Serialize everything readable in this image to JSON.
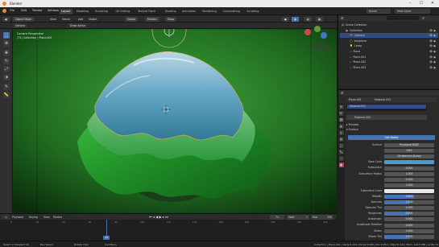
{
  "window": {
    "title": "Blender",
    "minimize": "–",
    "maximize": "☐",
    "close": "✕"
  },
  "menus": [
    "File",
    "Edit",
    "Render",
    "Window",
    "Help"
  ],
  "workspace_tabs": [
    "Layout",
    "Modeling",
    "Sculpting",
    "UV Editing",
    "Texture Paint",
    "Shading",
    "Animation",
    "Rendering",
    "Compositing",
    "Scripting"
  ],
  "active_workspace": "Layout",
  "scene": {
    "name": "Scene",
    "view_layer": "View Layer"
  },
  "viewport_header": {
    "editor": "Object Mode",
    "items": [
      "View",
      "Select",
      "Add",
      "Object"
    ],
    "left_pills": [
      "Options"
    ],
    "transform": [
      "Global",
      "Median"
    ],
    "snap": "Snap",
    "draw_mode": "Draw Active"
  },
  "viewport_info": {
    "line1": "Camera Perspective",
    "line2": "(74) Collection | Plane.001"
  },
  "outliner": {
    "title": "Scene Collection",
    "rows": [
      {
        "label": "Scene Collection",
        "selected": false,
        "indent": 0
      },
      {
        "label": "Collection",
        "selected": false,
        "indent": 1
      },
      {
        "label": "Camera",
        "selected": true,
        "indent": 2
      },
      {
        "label": "Icosphere",
        "selected": false,
        "indent": 2
      },
      {
        "label": "Lamp",
        "selected": false,
        "indent": 2
      },
      {
        "label": "Plane",
        "selected": false,
        "indent": 2
      },
      {
        "label": "Plane.001",
        "selected": false,
        "indent": 2
      },
      {
        "label": "Plane.002",
        "selected": false,
        "indent": 2
      },
      {
        "label": "Plane.003",
        "selected": false,
        "indent": 2
      }
    ]
  },
  "properties": {
    "object_tabs": [
      "Plane.001",
      "Material.003"
    ],
    "material_slot": "Material.003",
    "material_name": "Material.003",
    "sections": {
      "preview": "Preview",
      "surface": "Surface",
      "use_nodes": "Use Nodes"
    },
    "fields": [
      {
        "label": "Surface",
        "value": "Principled BSDF",
        "fill": 0
      },
      {
        "label": "",
        "value": "GGX",
        "fill": 0
      },
      {
        "label": "",
        "value": "Christensen-Burley",
        "fill": 0
      },
      {
        "label": "Base Color",
        "value": "",
        "fill": 0,
        "color": "#4e9bd1"
      },
      {
        "label": "Subsurface",
        "value": "0.000",
        "fill": 0
      },
      {
        "label": "Subsurface Radius",
        "value": "1.000",
        "fill": 0
      },
      {
        "label": "",
        "value": "0.200",
        "fill": 0
      },
      {
        "label": "",
        "value": "0.100",
        "fill": 0
      },
      {
        "label": "Subsurface Color",
        "value": "",
        "fill": 0,
        "color": "#e8e8e8"
      },
      {
        "label": "Metallic",
        "value": "0.600",
        "fill": 0.6
      },
      {
        "label": "Specular",
        "value": "0.500",
        "fill": 0.5
      },
      {
        "label": "Specular Tint",
        "value": "0.000",
        "fill": 0
      },
      {
        "label": "Roughness",
        "value": "0.500",
        "fill": 0.5
      },
      {
        "label": "Anisotropic",
        "value": "0.000",
        "fill": 0
      },
      {
        "label": "Anisotropic Rotation",
        "value": "0.000",
        "fill": 0
      },
      {
        "label": "Sheen",
        "value": "0.000",
        "fill": 0
      },
      {
        "label": "Sheen Tint",
        "value": "0.500",
        "fill": 0.5
      }
    ]
  },
  "timeline": {
    "playback": "Playback",
    "keying": "Keying",
    "view": "View",
    "marker": "Marker",
    "current_frame": "74",
    "start_label": "Start",
    "start": "1",
    "end_label": "End",
    "end": "250",
    "ticks": [
      "0",
      "20",
      "40",
      "60",
      "80",
      "100",
      "120",
      "140",
      "160",
      "180",
      "200",
      "220",
      "240"
    ]
  },
  "status": {
    "left": "Select or Deselect All",
    "mid1": "Box Select",
    "mid2": "Rotate View",
    "mid3": "Call Menu",
    "right": "Collection | Plane.001 | Verts:5,234 | Faces:4,996 | Tris:9,952 | Objects:1/6 | Mem: 124.5 MB | v2.80.74"
  },
  "colors": {
    "accent": "#4772b3",
    "selected_row": "#334d80",
    "viewport_bg": "#2a6f2a",
    "cloth_green": "#27a52f",
    "cloth_blue": "#7fb8d8"
  }
}
